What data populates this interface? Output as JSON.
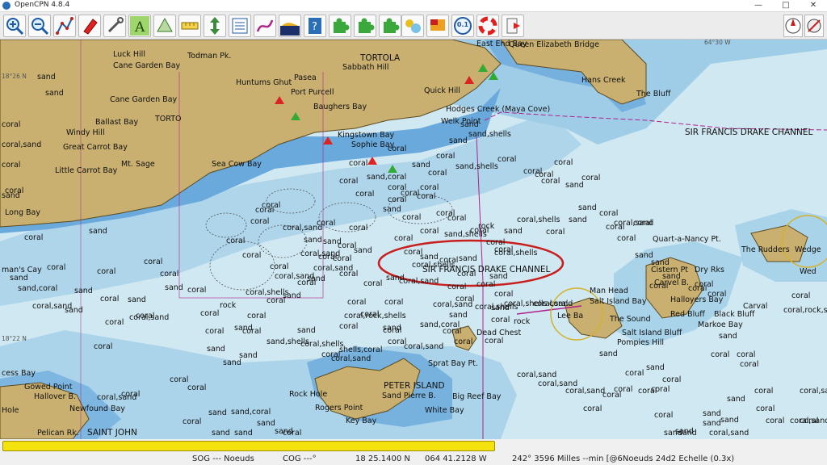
{
  "window": {
    "title": "OpenCPN 4.8.4",
    "minimize": "—",
    "maximize": "□",
    "close": "✕"
  },
  "toolbar": {
    "zoom_level_label": "0.1"
  },
  "chart": {
    "labels": [
      "Luck Hill",
      "Todman Pk.",
      "TORTOLA",
      "Sabbath Hill",
      "Pasea",
      "Huntums Ghut",
      "Port Purcell",
      "Baughers Bay",
      "Cane Garden Bay",
      "Cane Garden Bay",
      "TORTO",
      "Ballast Bay",
      "Windy Hill",
      "Great Carrot Bay",
      "Mt. Sage",
      "Little Carrot Bay",
      "Sea Cow Bay",
      "Kingstown Bay",
      "Sophie Bay",
      "Long Bay",
      "man's Cay",
      "SAINT JOHN",
      "Pelican Rk.",
      "Gowed Point",
      "Hallover B.",
      "Newfound Bay",
      "Hole",
      "cess Bay",
      "PETER ISLAND",
      "Sand Pierre B.",
      "Sprat Bay Pt.",
      "Rock Hole",
      "Rogers Point",
      "Key Bay",
      "Big Reef Bay",
      "White Bay",
      "Dead Chest",
      "SIR FRANCIS DRAKE CHANNEL",
      "SIR FRANCIS DRAKE CHANNEL",
      "Queen Elizabeth Bridge",
      "Hans Creek",
      "The Bluff",
      "East End Bay",
      "Quick Hill",
      "Hodges Creek (Maya Cove)",
      "Welk Point",
      "Quart-a-Nancy Pt.",
      "Cistern Pt",
      "Dry Rks",
      "Carvel B.",
      "Man Head",
      "Salt Island Bay",
      "Halloyers Bay",
      "Carval",
      "Red Bluff",
      "Black Bluff",
      "Markoe Bay",
      "The Rudders",
      "Wedge",
      "Wed",
      "Lee Ba",
      "The Sound",
      "Salt Island Bluff",
      "Pompies Hill",
      "sand",
      "sand",
      "coral",
      "coral,sand",
      "coral",
      "coral",
      "sand",
      "sand,coral",
      "coral,sand",
      "sand",
      "coral",
      "sand",
      "coral",
      "coral",
      "coral",
      "coral",
      "sand",
      "sand",
      "sand",
      "coral",
      "sand",
      "coral",
      "coral",
      "coral,sand",
      "coral",
      "coral",
      "sand",
      "sand,shells",
      "coral",
      "coral,shells",
      "coral,shells",
      "sand,shells",
      "coral",
      "sand",
      "coral",
      "coral",
      "coral",
      "coral",
      "rock",
      "coral",
      "coral",
      "sand",
      "coral",
      "coral",
      "coral",
      "coral",
      "sand",
      "coral",
      "coral",
      "sand",
      "coral",
      "sand",
      "coral",
      "coral,sand",
      "coral",
      "coral",
      "coral",
      "sand",
      "sand",
      "coral",
      "sand",
      "coral",
      "coral",
      "coral",
      "sand",
      "coral",
      "coral",
      "sand",
      "coral",
      "coral",
      "coral",
      "coral",
      "coral,sand",
      "sand",
      "coral,sand",
      "coral,sand",
      "coral",
      "coral",
      "coral",
      "coral",
      "sand",
      "sand",
      "sand",
      "coral",
      "sand",
      "sand",
      "coral",
      "sand",
      "coral",
      "coral",
      "coral,sand",
      "sand",
      "coral,sand",
      "coral",
      "coral,sand",
      "coral",
      "coral,rock,shells",
      "coral,sand",
      "coral",
      "coral",
      "sand",
      "sand",
      "sand",
      "coral",
      "coral",
      "coral",
      "sand",
      "sand,coral",
      "sand",
      "sand",
      "coral",
      "sand",
      "sand",
      "coral",
      "coral",
      "coral",
      "rock",
      "coral,shells",
      "coral",
      "coral",
      "sand",
      "sand,shells",
      "coral,shells",
      "sand",
      "coral",
      "shells,coral",
      "coral,sand",
      "coral",
      "sand",
      "sand",
      "coral,sand",
      "coral",
      "coral",
      "coral",
      "coral",
      "coral",
      "coral",
      "coral,sand",
      "sand",
      "coral",
      "coral,sand",
      "coral,sand",
      "coral",
      "coral",
      "sand",
      "coral",
      "coral",
      "sand",
      "coral,sand",
      "coral,shells",
      "coral",
      "coral,sand",
      "sand",
      "sand,coral",
      "coral",
      "coral",
      "coral",
      "coral",
      "coral,sand",
      "coral",
      "coral,rock,shells",
      "coral",
      "coral",
      "sand",
      "coral",
      "coral",
      "coral",
      "sand",
      "coral",
      "coral",
      "coral",
      "sand",
      "coral,shells",
      "rock",
      "sand",
      "coral,sand",
      "coral",
      "coral,shells",
      "coral",
      "coral",
      "coral",
      "coral",
      "coral",
      "coral",
      "sand,coral",
      "coral",
      "coral",
      "coral",
      "coral",
      "sand",
      "sand",
      "sand,shells",
      "coral",
      "sand",
      "coral",
      "coral",
      "coral",
      "coral",
      "sand"
    ],
    "lat_upper": "18°26 N",
    "lat_lower": "18°22 N",
    "lon_top": "64°30 W"
  },
  "status": {
    "sog": "SOG --- Noeuds",
    "cog": "COG ---°",
    "lat": "18 25.1400 N",
    "lon": "064 41.2128 W",
    "range_bearing": "242°  3596 Milles --min [@6Noeuds 24d2 Echelle (0.3x)"
  },
  "colors": {
    "land": "#c9b070",
    "shallow": "#6aa9dc",
    "medium": "#9fcde7",
    "deep": "#cfe8f1",
    "highlight_ring": "#c81e1e",
    "progress": "#f4e20e"
  }
}
